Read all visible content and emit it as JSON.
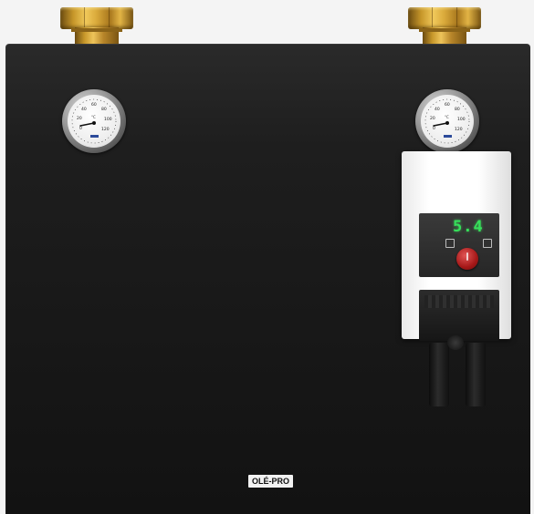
{
  "product": {
    "brand_label": "OLÉ-PRO"
  },
  "pump": {
    "display_value": "5.4",
    "display_color": "#36e05a",
    "power_button_color": "#b41c1c",
    "housing_color": "#ffffff"
  },
  "gauges": [
    {
      "name": "left-thermometer",
      "scale": [
        "0",
        "20",
        "40",
        "60",
        "80",
        "100",
        "120"
      ],
      "unit": "°C"
    },
    {
      "name": "right-thermometer",
      "scale": [
        "0",
        "20",
        "40",
        "60",
        "80",
        "100",
        "120"
      ],
      "unit": "°C"
    }
  ],
  "colors": {
    "cabinet": "#1a1a1a",
    "brass": "#d9a93a",
    "background": "#f4f4f4"
  }
}
